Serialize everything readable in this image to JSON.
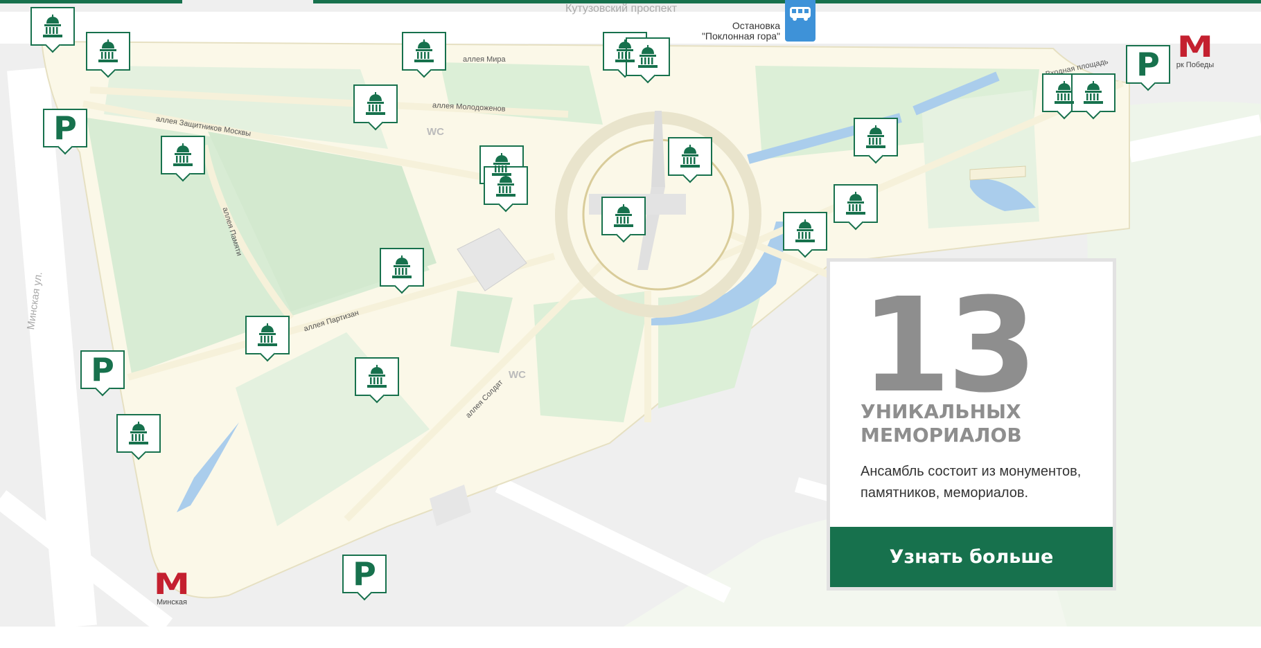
{
  "map": {
    "street_top": "Кутузовский проспект",
    "street_left": "Минская ул.",
    "bus_stop": {
      "line1": "Остановка",
      "line2": "\"Поклонная гора\"",
      "icon": "bus-icon"
    },
    "alleys": {
      "mira": "аллея Мира",
      "molodozhenov": "аллея Молодоженов",
      "zashchitnikov": "аллея Защитников Москвы",
      "pamyati": "аллея Памяти",
      "partizan": "аллея Партизан",
      "soldat": "аллея Солдат",
      "vhodnaya": "Входная площадь"
    },
    "wc_label": "WC",
    "metro": [
      {
        "letter": "М",
        "name": "Минская"
      },
      {
        "letter": "М",
        "name": "рк Победы"
      }
    ],
    "parking_label": "P",
    "marker_icon": "museum-icon",
    "colors": {
      "accent": "#17714d",
      "metro": "#c4202f",
      "water": "#aacdec",
      "lawn": "#d8ecd4",
      "path": "#fbf8e8"
    }
  },
  "card": {
    "number": "13",
    "heading_line1": "УНИКАЛЬНЫХ",
    "heading_line2": "МЕМОРИАЛОВ",
    "text": "Ансамбль состоит из монументов, памятников, мемориалов.",
    "button": "Узнать больше"
  }
}
